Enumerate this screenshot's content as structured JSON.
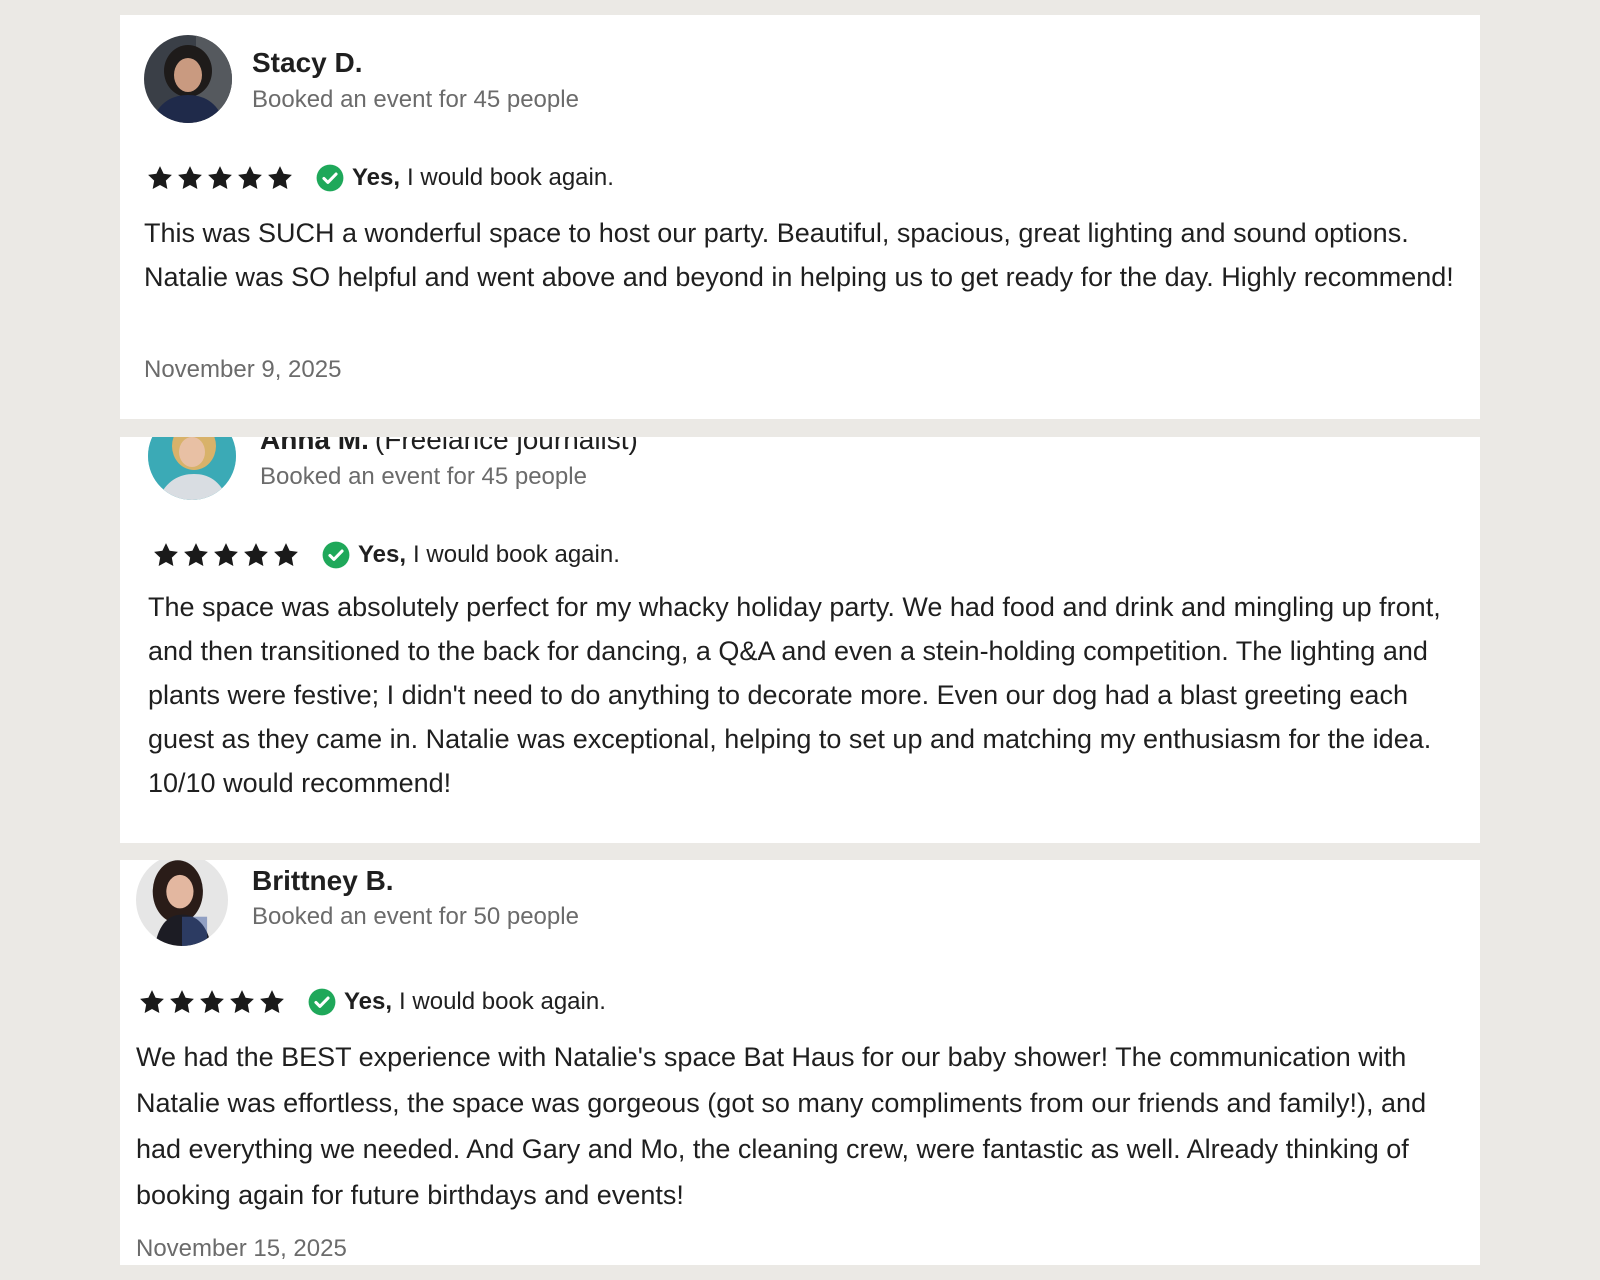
{
  "colors": {
    "background": "#ebe9e5",
    "card": "#ffffff",
    "star": "#1a1a1a",
    "check": "#1fa85a",
    "muted": "#6b6b6b"
  },
  "reviews": [
    {
      "name": "Stacy D.",
      "role": "",
      "booked": "Booked an event for 45 people",
      "rating": 5,
      "rebook_yes": "Yes,",
      "rebook_rest": "I would book again.",
      "text": "This was SUCH a wonderful space to host our party. Beautiful, spacious, great lighting and sound options. Natalie was SO helpful and went above and beyond in helping us to get ready for the day. Highly recommend!",
      "date": "November 9, 2025"
    },
    {
      "name": "Anna M.",
      "role": "(Freelance journalist)",
      "booked": "Booked an event for 45 people",
      "rating": 5,
      "rebook_yes": "Yes,",
      "rebook_rest": "I would book again.",
      "text": "The space was absolutely perfect for my whacky holiday party. We had food and drink and mingling up front, and then transitioned to the back for dancing, a Q&A and even a stein-holding competition. The lighting and plants were festive; I didn't need to do anything to decorate more. Even our dog had a blast greeting each guest as they came in. Natalie was exceptional, helping to set up and matching my enthusiasm for the idea. 10/10 would recommend!"
    },
    {
      "name": "Brittney B.",
      "role": "",
      "booked": "Booked an event for 50 people",
      "rating": 5,
      "rebook_yes": "Yes,",
      "rebook_rest": "I would book again.",
      "text": "We had the BEST experience with Natalie's space Bat Haus for our baby shower! The communication with Natalie was effortless, the space was gorgeous (got so many compliments from our friends and family!), and had everything we needed. And Gary and Mo, the cleaning crew, were fantastic as well. Already thinking of booking again for future birthdays and events!",
      "date": "November 15, 2025"
    }
  ]
}
